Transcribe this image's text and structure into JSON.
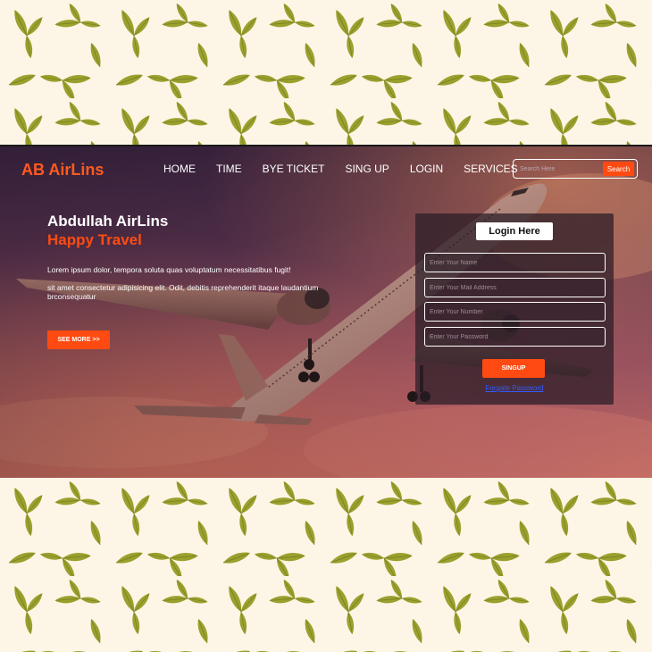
{
  "brand": {
    "name": "AB AirLins",
    "accent": "#ff4b12"
  },
  "nav": {
    "items": [
      {
        "label": "HOME"
      },
      {
        "label": "TIME"
      },
      {
        "label": "BYE TICKET"
      },
      {
        "label": "SING UP"
      },
      {
        "label": "LOGIN"
      },
      {
        "label": "SERVICES"
      }
    ]
  },
  "search": {
    "placeholder": "Search Here",
    "value": "",
    "button_label": "Search"
  },
  "hero": {
    "title": "Abdullah AirLins",
    "subtitle": "Happy Travel",
    "paragraph_1": "Lorem ipsum dolor, tempora soluta quas voluptatum necessitatibus fugit!",
    "paragraph_2": "sit amet consectetur adipisicing elit. Odit, debitis reprehenderit itaque laudantium brconsequatur",
    "cta_label": "SEE MORE >>"
  },
  "login": {
    "heading": "Login Here",
    "fields": [
      {
        "placeholder": "Enter Your Name",
        "value": ""
      },
      {
        "placeholder": "Enter Your Mail Address",
        "value": ""
      },
      {
        "placeholder": "Enter Your Number",
        "value": ""
      },
      {
        "placeholder": "Enter Your Password",
        "value": ""
      }
    ],
    "submit_label": "SINGUP",
    "forgot_label": "Forgate Password"
  },
  "colors": {
    "wallpaper_bg": "#fdf6e6",
    "leaf": "#9aa12e",
    "button": "#ff4b12",
    "link": "#2f5bff"
  },
  "icons": [
    "leaf-pattern",
    "airplane-image"
  ]
}
